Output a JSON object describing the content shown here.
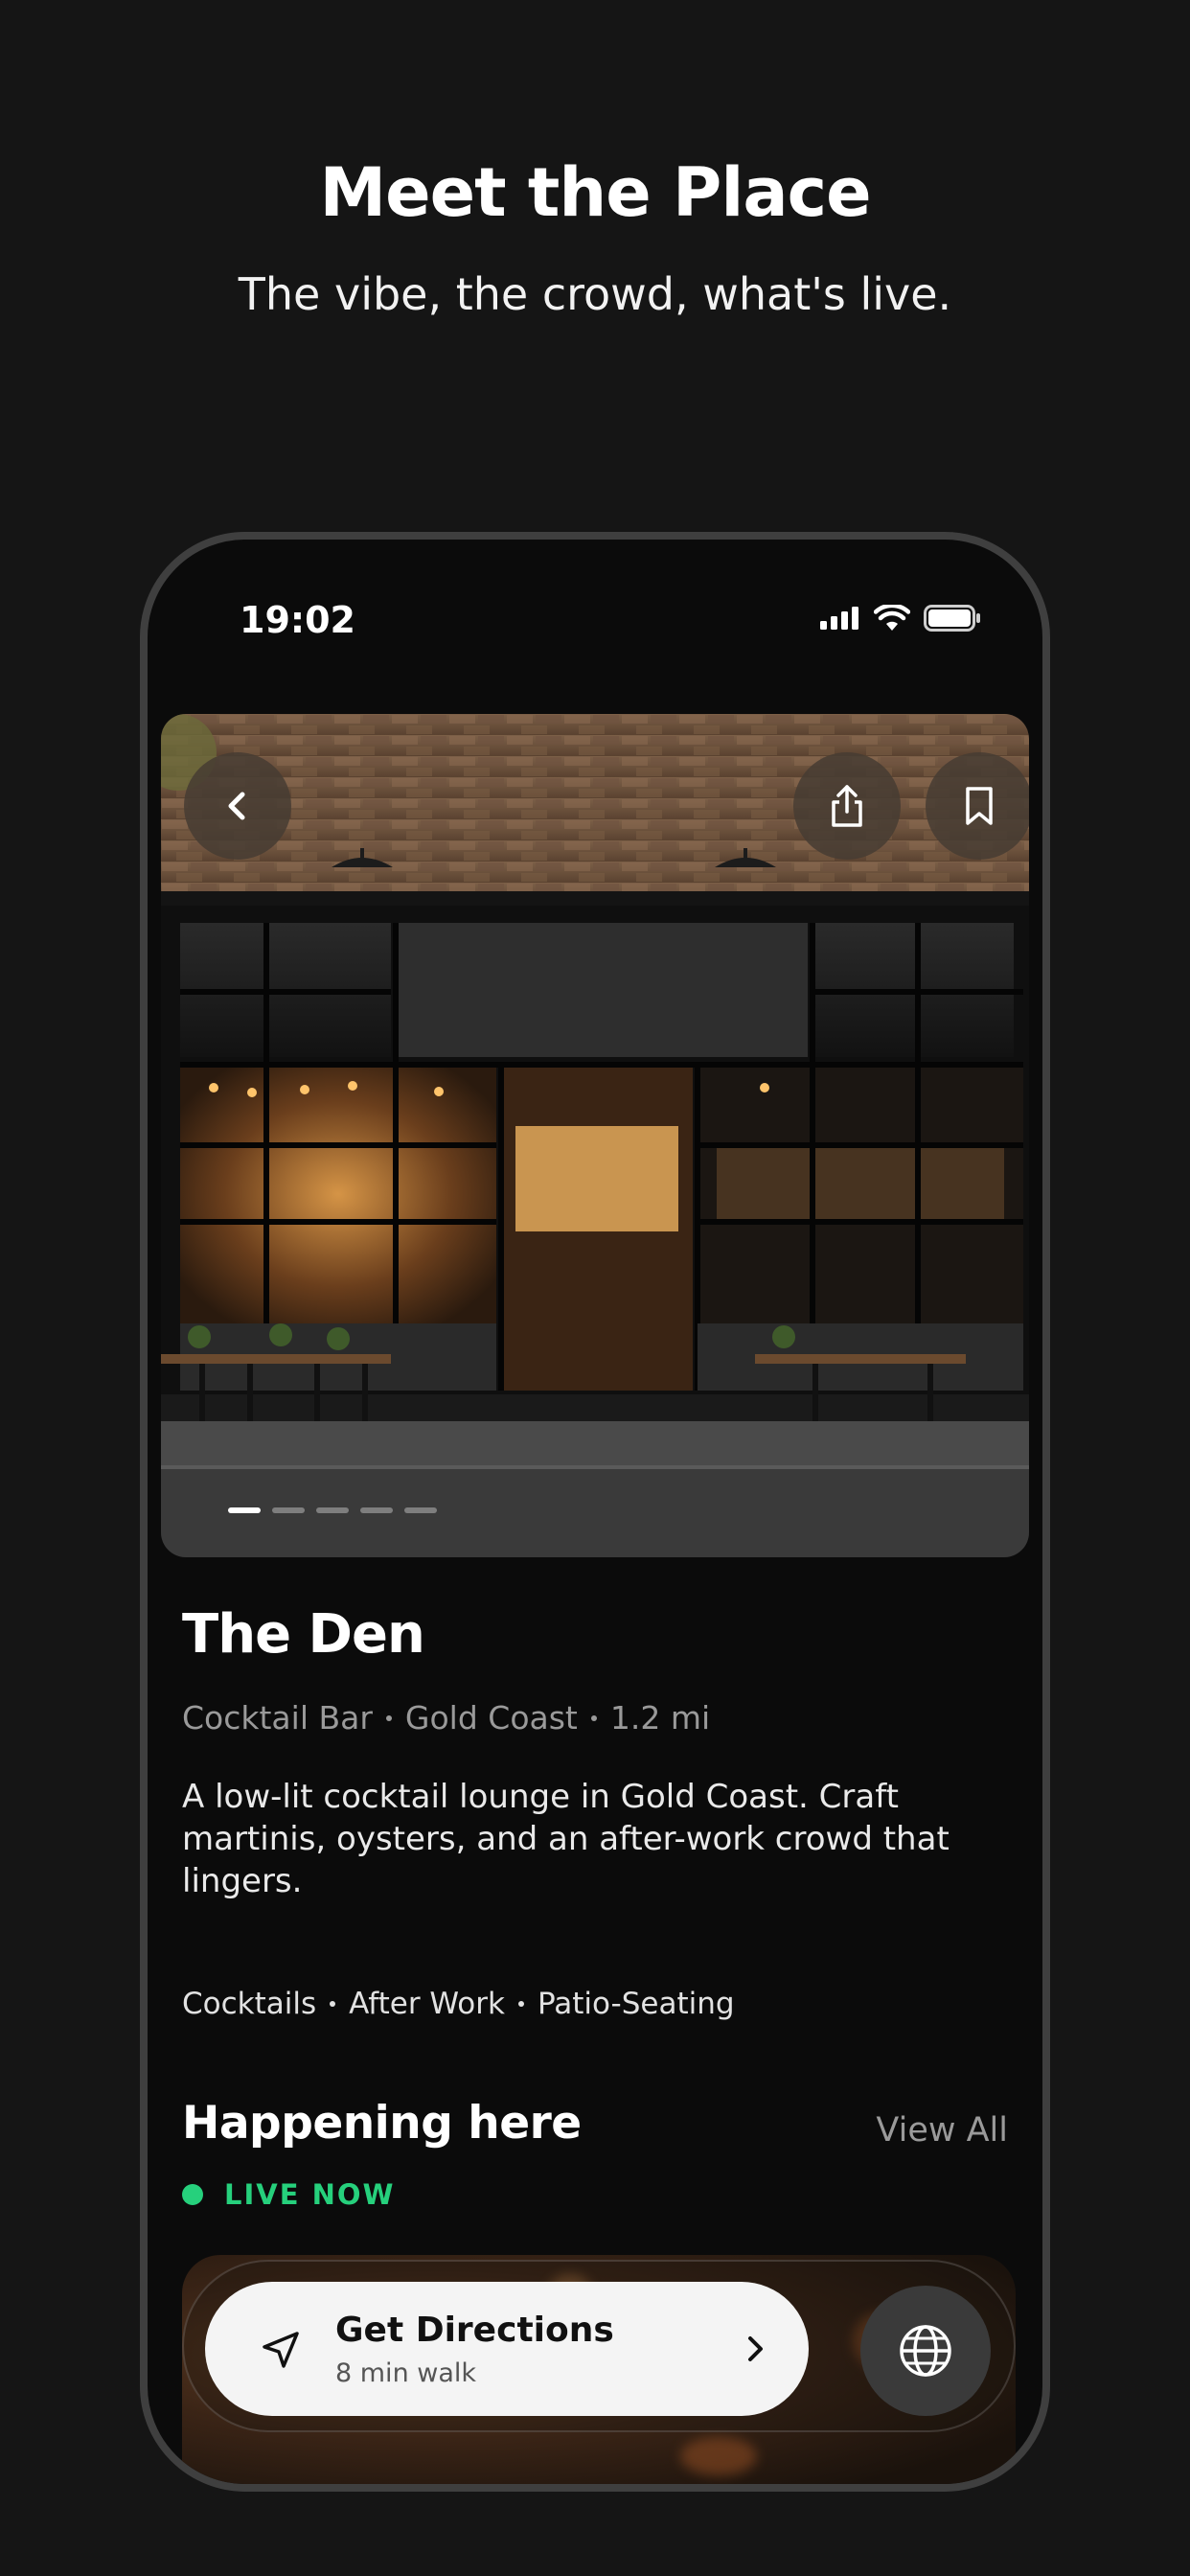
{
  "hero": {
    "title": "Meet the Place",
    "subtitle": "The vibe, the crowd, what's live."
  },
  "status_bar": {
    "time": "19:02",
    "icons": [
      "signal-icon",
      "wifi-icon",
      "battery-icon"
    ]
  },
  "photo": {
    "icons": [
      "chevron-left-icon",
      "share-icon",
      "bookmark-icon"
    ],
    "carousel_total": 5,
    "carousel_active": 1
  },
  "venue": {
    "name": "The Den",
    "meta": [
      "Cocktail Bar",
      "Gold Coast",
      "1.2 mi"
    ],
    "description": "A low-lit cocktail lounge in Gold Coast. Craft martinis, oysters, and an after-work crowd that lingers.",
    "tags": [
      "Cocktails",
      "After Work",
      "Patio-Seating"
    ]
  },
  "happening": {
    "title": "Happening here",
    "view_all": "View All",
    "live_label": "LIVE NOW"
  },
  "action_bar": {
    "directions_label": "Get Directions",
    "directions_sub": "8 min walk",
    "icons": [
      "navigation-arrow-icon",
      "chevron-right-icon",
      "globe-icon"
    ]
  },
  "colors": {
    "background": "#151515",
    "live_accent": "#26d07c",
    "button_light": "#f4f4f4"
  }
}
